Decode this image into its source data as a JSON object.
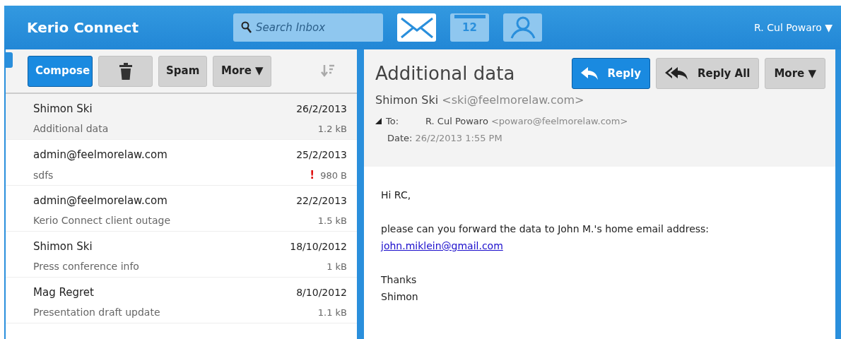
{
  "app_title": "Kerio Connect",
  "search": {
    "placeholder": "Search Inbox"
  },
  "modules": [
    {
      "kind": "mail",
      "selected": true
    },
    {
      "kind": "calendar",
      "label": "12",
      "selected": false
    },
    {
      "kind": "contacts",
      "selected": false
    }
  ],
  "user": {
    "name": "R. Cul Powaro",
    "caret": "▼"
  },
  "list_toolbar": [
    {
      "kind": "primary",
      "label": "Compose"
    },
    {
      "kind": "delete"
    },
    {
      "kind": "plain",
      "label": "Spam"
    },
    {
      "kind": "menu",
      "label": "More",
      "caret": "▼"
    }
  ],
  "messages": [
    {
      "sender": "Shimon Ski",
      "date": "26/2/2013",
      "subject": "Additional data",
      "size": "1.2 kB",
      "selected": true
    },
    {
      "sender": "admin@feelmorelaw.com",
      "date": "25/2/2013",
      "subject": "sdfs",
      "size": "980 B",
      "flag": "!",
      "selected": false
    },
    {
      "sender": "admin@feelmorelaw.com",
      "date": "22/2/2013",
      "subject": "Kerio Connect client outage",
      "size": "1.5 kB",
      "selected": false
    },
    {
      "sender": "Shimon Ski",
      "date": "18/10/2012",
      "subject": "Press conference info",
      "size": "1 kB",
      "selected": false
    },
    {
      "sender": "Mag Regret",
      "date": "8/10/2012",
      "subject": "Presentation draft update",
      "size": "1.1 kB",
      "selected": false
    }
  ],
  "reading_pane": {
    "subject": "Additional data",
    "actions": [
      {
        "kind": "reply",
        "label": "Reply"
      },
      {
        "kind": "reply_all",
        "label": "Reply All"
      },
      {
        "kind": "menu",
        "label": "More",
        "caret": "▼"
      }
    ],
    "from_name": "Shimon Ski",
    "from_email": "<ski@feelmorelaw.com>",
    "to_label": "To:",
    "to_name": "R. Cul Powaro",
    "to_email": "<powaro@feelmorelaw.com>",
    "details_expanded": true,
    "date_label": "Date:",
    "date": "26/2/2013 1:55 PM",
    "body": [
      {
        "kind": "text",
        "text": "Hi RC,"
      },
      {
        "kind": "gap"
      },
      {
        "kind": "text",
        "text": "please can you forward the data to John M.'s home email address:"
      },
      {
        "kind": "link",
        "text": "john.miklein@gmail.com"
      },
      {
        "kind": "gap"
      },
      {
        "kind": "text",
        "text": "Thanks"
      },
      {
        "kind": "text",
        "text": "Shimon"
      }
    ]
  }
}
